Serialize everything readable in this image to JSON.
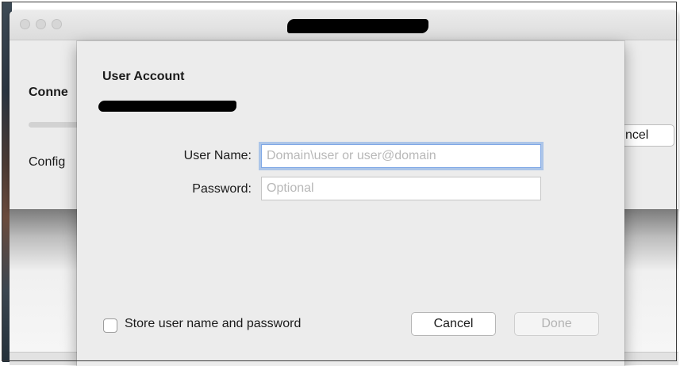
{
  "background_window": {
    "heading_partial": "Conne",
    "config_partial": "Config",
    "cancel_partial": "ncel"
  },
  "sheet": {
    "title": "User Account",
    "username": {
      "label": "User Name:",
      "value": "",
      "placeholder": "Domain\\user or user@domain"
    },
    "password": {
      "label": "Password:",
      "value": "",
      "placeholder": "Optional"
    },
    "store_credentials": {
      "label": "Store user name and password",
      "checked": false
    },
    "cancel_label": "Cancel",
    "done_label": "Done"
  },
  "colors": {
    "focus_ring": "#7fa8e6",
    "sheet_background": "#ececec",
    "disabled_text": "#b3b3b3"
  }
}
